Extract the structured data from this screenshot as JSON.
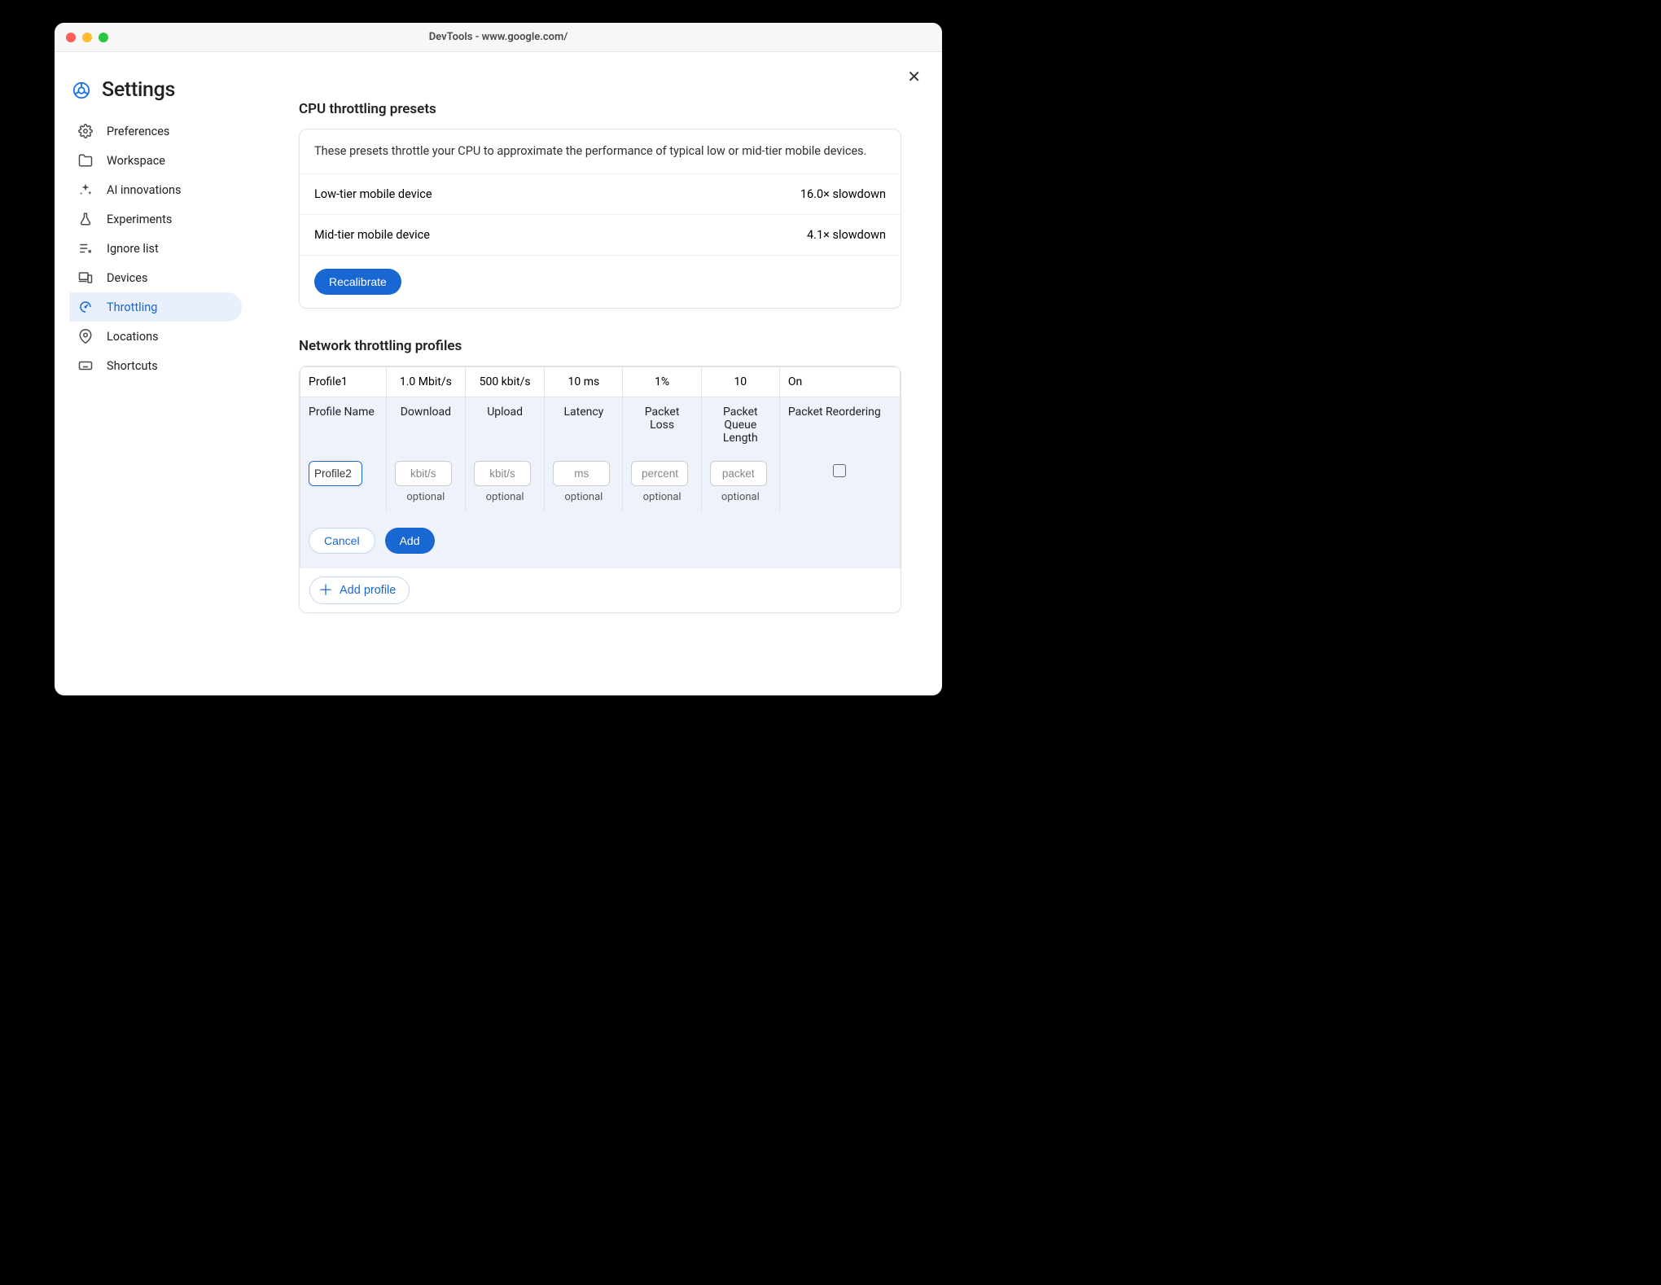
{
  "window": {
    "title": "DevTools - www.google.com/"
  },
  "header": {
    "title": "Settings"
  },
  "sidebar": {
    "items": [
      {
        "label": "Preferences"
      },
      {
        "label": "Workspace"
      },
      {
        "label": "AI innovations"
      },
      {
        "label": "Experiments"
      },
      {
        "label": "Ignore list"
      },
      {
        "label": "Devices"
      },
      {
        "label": "Throttling"
      },
      {
        "label": "Locations"
      },
      {
        "label": "Shortcuts"
      }
    ]
  },
  "cpu": {
    "section_title": "CPU throttling presets",
    "description": "These presets throttle your CPU to approximate the performance of typical low or mid-tier mobile devices.",
    "presets": [
      {
        "name": "Low-tier mobile device",
        "value": "16.0× slowdown"
      },
      {
        "name": "Mid-tier mobile device",
        "value": "4.1× slowdown"
      }
    ],
    "recalibrate_label": "Recalibrate"
  },
  "network": {
    "section_title": "Network throttling profiles",
    "profile_row": {
      "name": "Profile1",
      "download": "1.0 Mbit/s",
      "upload": "500 kbit/s",
      "latency": "10 ms",
      "packet_loss": "1%",
      "queue_length": "10",
      "reordering": "On"
    },
    "columns": {
      "name": "Profile Name",
      "download": "Download",
      "upload": "Upload",
      "latency": "Latency",
      "packet_loss": "Packet Loss",
      "queue_length": "Packet Queue Length",
      "reordering": "Packet Reordering"
    },
    "new_profile": {
      "name_value": "Profile2",
      "download_placeholder": "kbit/s",
      "upload_placeholder": "kbit/s",
      "latency_placeholder": "ms",
      "packet_loss_placeholder": "percent",
      "queue_placeholder": "packet",
      "optional_hint": "optional"
    },
    "cancel_label": "Cancel",
    "add_label": "Add",
    "add_profile_label": "Add profile"
  }
}
